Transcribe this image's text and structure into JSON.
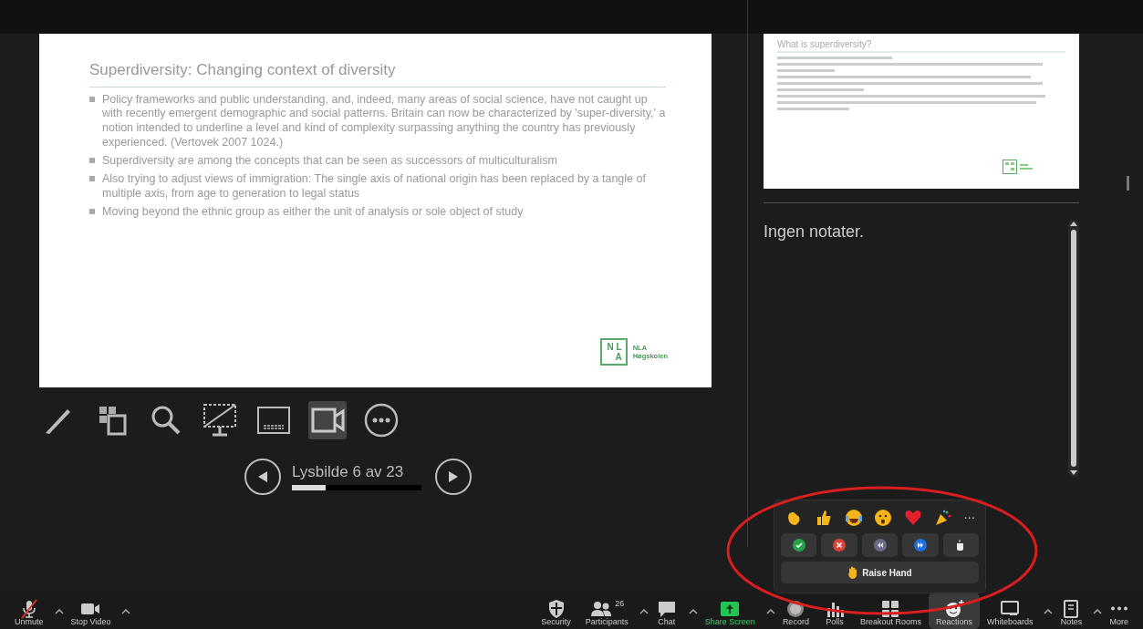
{
  "slide": {
    "title": "Superdiversity: Changing context of diversity",
    "bullets": [
      "Policy frameworks and public understanding, and, indeed, many areas of social science, have not caught up with recently emergent demographic and social patterns. Britain can now be characterized by 'super-diversity,' a notion intended to underline a level and kind of complexity surpassing anything the country has previously experienced. (Vertovek 2007 1024.)",
      "Superdiversity are among the concepts that can be seen as successors of multiculturalism",
      "Also trying to adjust views of immigration: The single axis of national origin has been replaced by a tangle of multiple axis, from age to generation to legal status",
      "Moving beyond the ethnic group as either the unit of analysis or sole object of study"
    ],
    "logo_letters": [
      "N L",
      "A"
    ],
    "logo_name": "NLA",
    "logo_subtitle": "Høgskolen"
  },
  "thumbnail": {
    "title": "What is superdiversity?"
  },
  "notes": {
    "text": "Ingen notater."
  },
  "presenter_tools": [
    {
      "kind": "pen",
      "selected": false
    },
    {
      "kind": "slides",
      "selected": false
    },
    {
      "kind": "zoom",
      "selected": false
    },
    {
      "kind": "black-screen",
      "selected": false
    },
    {
      "kind": "subtitles",
      "selected": false
    },
    {
      "kind": "camera",
      "selected": true
    },
    {
      "kind": "more",
      "selected": false
    }
  ],
  "slide_nav": {
    "label": "Lysbilde 6 av 23",
    "level": 0.26
  },
  "reactions_popup": {
    "emojis": [
      {
        "kind": "clap"
      },
      {
        "kind": "thumbs-up"
      },
      {
        "kind": "laugh"
      },
      {
        "kind": "wow"
      },
      {
        "kind": "heart"
      },
      {
        "kind": "party"
      }
    ],
    "more": "···",
    "feedback": [
      {
        "kind": "yes"
      },
      {
        "kind": "no"
      },
      {
        "kind": "slower"
      },
      {
        "kind": "faster"
      },
      {
        "kind": "coffee"
      }
    ],
    "raise_hand": "Raise Hand"
  },
  "toolbar": [
    {
      "kind": "mic",
      "label": "Unmute",
      "muted": true,
      "caret": true,
      "selected": false
    },
    {
      "kind": "video",
      "label": "Stop Video",
      "caret": true,
      "selected": false
    },
    {
      "kind": "security",
      "label": "Security",
      "caret": false,
      "selected": false
    },
    {
      "kind": "participants",
      "label": "Participants",
      "count": "26",
      "caret": true,
      "selected": false
    },
    {
      "kind": "chat",
      "label": "Chat",
      "caret": true,
      "selected": false
    },
    {
      "kind": "share",
      "label": "Share Screen",
      "caret": true,
      "selected": false
    },
    {
      "kind": "record",
      "label": "Record",
      "caret": false,
      "selected": false
    },
    {
      "kind": "polls",
      "label": "Polls",
      "caret": false,
      "selected": false
    },
    {
      "kind": "breakout",
      "label": "Breakout Rooms",
      "caret": false,
      "selected": false
    },
    {
      "kind": "reactions",
      "label": "Reactions",
      "caret": false,
      "selected": true
    },
    {
      "kind": "whiteboard",
      "label": "Whiteboards",
      "caret": true,
      "selected": false
    },
    {
      "kind": "notes",
      "label": "Notes",
      "caret": true,
      "selected": false
    },
    {
      "kind": "more",
      "label": "More",
      "caret": false,
      "selected": false
    }
  ]
}
